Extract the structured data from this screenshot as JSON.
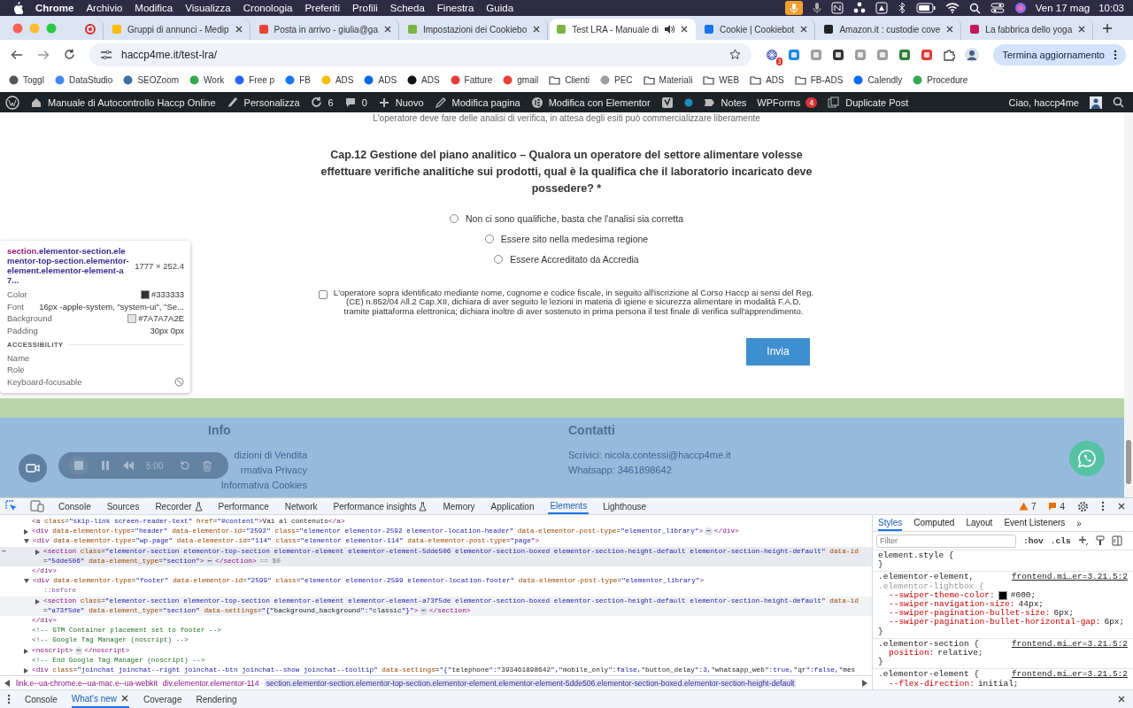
{
  "menu_bar": {
    "app": "Chrome",
    "menus": [
      "Archivio",
      "Modifica",
      "Visualizza",
      "Cronologia",
      "Preferiti",
      "Profili",
      "Scheda",
      "Finestra",
      "Guida"
    ],
    "date": "Ven 17 mag",
    "time": "10:03"
  },
  "tabs": [
    {
      "kind": "pinned",
      "selected": false,
      "audio": false,
      "color": "#d93025"
    },
    {
      "kind": "normal",
      "title": "Gruppi di annunci - Medip",
      "selected": false,
      "audio": false,
      "color": "#fbbc04"
    },
    {
      "kind": "normal",
      "title": "Posta in arrivo - giulia@ga",
      "selected": false,
      "audio": false,
      "color": "#ea4335"
    },
    {
      "kind": "normal",
      "title": "Impostazioni dei Cookiebo",
      "selected": false,
      "audio": false,
      "color": "#7cb342"
    },
    {
      "kind": "normal",
      "title": "Test LRA - Manuale di",
      "selected": true,
      "audio": true,
      "color": "#7cb342"
    },
    {
      "kind": "normal",
      "title": "Cookie | Cookiebot",
      "selected": false,
      "audio": false,
      "color": "#1a73e8"
    },
    {
      "kind": "normal",
      "title": "Amazon.it : custodie cove",
      "selected": false,
      "audio": false,
      "color": "#222222"
    },
    {
      "kind": "normal",
      "title": "La fabbrica dello yoga",
      "selected": false,
      "audio": false,
      "color": "#c2185b"
    }
  ],
  "address_bar": {
    "url": "haccp4me.it/test-lra/"
  },
  "extension_badge": "3",
  "update_button": "Termina aggiornamento",
  "bookmarks": [
    {
      "kind": "site",
      "label": "Toggl",
      "color": "#555555"
    },
    {
      "kind": "site",
      "label": "DataStudio",
      "color": "#4285f4"
    },
    {
      "kind": "site",
      "label": "SEOZoom",
      "color": "#3c6e9f"
    },
    {
      "kind": "site",
      "label": "Work",
      "color": "#34a853"
    },
    {
      "kind": "site",
      "label": "Free p",
      "color": "#2962ff"
    },
    {
      "kind": "site",
      "label": "FB",
      "color": "#1877f2"
    },
    {
      "kind": "site",
      "label": "ADS",
      "color": "#fbbc04"
    },
    {
      "kind": "site",
      "label": "ADS",
      "color": "#0668e1"
    },
    {
      "kind": "site",
      "label": "ADS",
      "color": "#111111"
    },
    {
      "kind": "site",
      "label": "Fatture",
      "color": "#e53935"
    },
    {
      "kind": "site",
      "label": "gmail",
      "color": "#ea4335"
    },
    {
      "kind": "folder",
      "label": "Clienti"
    },
    {
      "kind": "site",
      "label": "PEC",
      "color": "#9e9e9e"
    },
    {
      "kind": "folder",
      "label": "Materiali"
    },
    {
      "kind": "folder",
      "label": "WEB"
    },
    {
      "kind": "folder",
      "label": "ADS"
    },
    {
      "kind": "folder",
      "label": "FB-ADS"
    },
    {
      "kind": "site",
      "label": "Calendly",
      "color": "#006bff"
    },
    {
      "kind": "site",
      "label": "Procedure",
      "color": "#34a853"
    }
  ],
  "admin_bar": {
    "items": [
      {
        "label": "Manuale di Autocontrollo Haccp Online"
      },
      {
        "label": "Personalizza"
      },
      {
        "label": "6"
      },
      {
        "label": "0"
      },
      {
        "label": "Nuovo"
      },
      {
        "label": "Modifica pagina"
      },
      {
        "label": "Modifica con Elementor"
      },
      {
        "label": "Notes"
      },
      {
        "label": "WPForms",
        "badge": "4"
      },
      {
        "label": "Duplicate Post"
      }
    ],
    "greeting": "Ciao, haccp4me"
  },
  "page": {
    "previous_option": "L'operatore deve fare delle analisi di verifica, in attesa degli esiti può commercializzare liberamente",
    "question": "Cap.12 Gestione del piano analitico – Qualora un operatore del settore alimentare volesse effettuare verifiche analitiche sui prodotti, qual è la qualifica che il laboratorio incaricato deve possedere? *",
    "options": [
      {
        "label": "Non ci sono qualifiche, basta che l'analisi sia corretta",
        "selected": false
      },
      {
        "label": "Essere sito nella medesima regione",
        "selected": false
      },
      {
        "label": "Essere Accreditato da Accredia",
        "selected": false
      }
    ],
    "consent": {
      "text": "L'operatore sopra identificato mediante nome, cognome e codice fiscale, in seguito all'iscrizione al Corso Haccp ai sensi del Reg.(CE) n.852/04 All.2 Cap.XII, dichiara di aver seguito le lezioni in materia di igiene e sicurezza alimentare in modalità F.A.D. tramite piattaforma elettronica; dichiara inoltre di aver sostenuto in prima persona il test finale di verifica sull'apprendimento.",
      "checked": false
    },
    "submit": "Invia"
  },
  "footer": {
    "columns": [
      {
        "heading": "Info",
        "links": [
          "dizioni di Vendita",
          "rmativa Privacy",
          "Informativa Cookies"
        ]
      },
      {
        "heading": "Contatti",
        "links": [
          "Scrivici: nicola.contessi@haccp4me.it",
          "Whatsapp: 3461898642"
        ]
      }
    ]
  },
  "recorder": {
    "time": "5:00"
  },
  "inspector_tooltip": {
    "tag": "section",
    "classes": ".elementor-section.elementor-top-section.elementor-element.elementor-element-a7...",
    "size": "1777 × 252.4",
    "rows": [
      {
        "label": "Color",
        "value": "#333333",
        "color": "#333333"
      },
      {
        "label": "Font",
        "value": "16px -apple-system, \"system-ui\", \"Se..."
      },
      {
        "label": "Background",
        "value": "#7A7A7A2E",
        "color": "#e4e4e4"
      },
      {
        "label": "Padding",
        "value": "30px 0px"
      }
    ],
    "section": "ACCESSIBILITY",
    "a11y": [
      {
        "label": "Name"
      },
      {
        "label": "Role"
      },
      {
        "label": "Keyboard-focusable",
        "focusable": false
      }
    ]
  },
  "devtools": {
    "tabs": [
      {
        "label": "Console",
        "selected": false,
        "experimental": false
      },
      {
        "label": "Sources",
        "selected": false,
        "experimental": false
      },
      {
        "label": "Recorder",
        "selected": false,
        "experimental": true
      },
      {
        "label": "Performance",
        "selected": false,
        "experimental": false
      },
      {
        "label": "Network",
        "selected": false,
        "experimental": false
      },
      {
        "label": "Performance insights",
        "selected": false,
        "experimental": true
      },
      {
        "label": "Memory",
        "selected": false,
        "experimental": false
      },
      {
        "label": "Application",
        "selected": false,
        "experimental": false
      },
      {
        "label": "Elements",
        "selected": true,
        "experimental": false
      },
      {
        "label": "Lighthouse",
        "selected": false,
        "experimental": false
      }
    ],
    "warnings": "7",
    "issues": "4",
    "dom": [
      {
        "kind": "leaf",
        "open": "<a class=\"skip-link screen-reader-text\" href=\"#content\">Vai al contenuto</a>",
        "selected": false,
        "hovered": false
      },
      {
        "kind": "element",
        "open": "<div data-elementor-type=\"header\" data-elementor-id=\"2592\" class=\"elementor elementor-2592 elementor-location-header\" data-elementor-post-type=\"elementor_library\">",
        "badge": "⋯",
        "close": "</div>",
        "expanded": false,
        "selected": false,
        "hovered": false
      },
      {
        "kind": "element",
        "open": "<div data-elementor-type=\"wp-page\" data-elementor-id=\"114\" class=\"elementor elementor-114\" data-elementor-post-type=\"page\">",
        "close": "</div>",
        "expanded": true,
        "selected": false,
        "hovered": false,
        "children": [
          {
            "kind": "element",
            "open": "<section class=\"elementor-section elementor-top-section elementor-element elementor-element-5dde506 elementor-section-boxed elementor-section-height-default elementor-section-height-default\" data-id=\"5dde506\" data-element_type=\"section\">",
            "badge": "⋯",
            "close": "</section>",
            "gutter": "⋯",
            "marker": "== $0",
            "expanded": false,
            "selected": true,
            "hovered": false
          }
        ]
      },
      {
        "kind": "element",
        "open": "<div data-elementor-type=\"footer\" data-elementor-id=\"2599\" class=\"elementor elementor-2599 elementor-location-footer\" data-elementor-post-type=\"elementor_library\">",
        "close": "</div>",
        "expanded": true,
        "selected": false,
        "hovered": false,
        "children": [
          {
            "kind": "pseudo",
            "open": "::before",
            "selected": false,
            "hovered": false
          },
          {
            "kind": "element",
            "open": "<section class=\"elementor-section elementor-top-section elementor-element elementor-element-a73f5de elementor-section-boxed elementor-section-height-default elementor-section-height-default\" data-id=\"a73f5de\" data-element_type=\"section\" data-settings=\"{\"background_background\":\"classic\"}\">",
            "badge": "⋯",
            "close": "</section>",
            "expanded": false,
            "selected": false,
            "hovered": true
          }
        ]
      },
      {
        "kind": "comment",
        "open": "<!-- GTM Container placement set to footer -->",
        "selected": false,
        "hovered": false
      },
      {
        "kind": "comment",
        "open": "<!-- Google Tag Manager (noscript) -->",
        "selected": false,
        "hovered": false
      },
      {
        "kind": "element",
        "open": "<noscript>",
        "badge": "⋯",
        "close": "</noscript>",
        "expanded": false,
        "selected": false,
        "hovered": false
      },
      {
        "kind": "comment",
        "open": "<!-- End Google Tag Manager (noscript) -->",
        "selected": false,
        "hovered": false
      },
      {
        "kind": "element",
        "open": "<div class=\"joinchat joinchat--right joinchat--btn joinchat--show joinchat--tooltip\" data-settings=\"{\"telephone\":\"393461898642\",\"mobile_only\":false,\"button_delay\":3,\"whatsapp_web\":true,\"qr\":false,\"mes",
        "expanded": false,
        "selected": false,
        "hovered": false
      }
    ],
    "breadcrumbs": [
      {
        "text": "link.e--ua-chrome.e--ua-mac.e--ua-webkit",
        "selected": false
      },
      {
        "text": "div.elementor.elementor-114",
        "selected": false
      },
      {
        "text": "section.elementor-section.elementor-top-section.elementor-element.elementor-element-5dde506.elementor-section-boxed.elementor-section-height-default",
        "selected": true
      }
    ],
    "styles_tabs": [
      {
        "label": "Styles",
        "selected": true
      },
      {
        "label": "Computed",
        "selected": false
      },
      {
        "label": "Layout",
        "selected": false
      },
      {
        "label": "Event Listeners",
        "selected": false
      }
    ],
    "more_tabs": "»",
    "filter_placeholder": "Filter",
    "toggles": [
      ":hov",
      ".cls"
    ],
    "rules": [
      {
        "selector": [
          {
            "text": "element.style {",
            "matched": true
          }
        ],
        "close": "}"
      },
      {
        "selector": [
          {
            "text": ".elementor-element, ",
            "matched": true
          },
          {
            "text": ".elementor-lightbox {",
            "matched": false
          }
        ],
        "source": "frontend.mi…er=3.21.5:2",
        "close": "}",
        "props": [
          {
            "name": "--swiper-theme-color:",
            "value": "#000;",
            "color": "#000000"
          },
          {
            "name": "--swiper-navigation-size:",
            "value": "44px;"
          },
          {
            "name": "--swiper-pagination-bullet-size:",
            "value": "6px;"
          },
          {
            "name": "--swiper-pagination-bullet-horizontal-gap:",
            "value": "6px;"
          }
        ]
      },
      {
        "selector": [
          {
            "text": ".elementor-section {",
            "matched": true
          }
        ],
        "source": "frontend.mi…er=3.21.5:2",
        "close": "}",
        "props": [
          {
            "name": "position:",
            "value": "relative;"
          }
        ]
      },
      {
        "selector": [
          {
            "text": ".elementor-element {",
            "matched": true
          }
        ],
        "source": "frontend.mi…er=3.21.5:2",
        "props": [
          {
            "name": "--flex-direction:",
            "value": "initial;"
          }
        ]
      }
    ],
    "drawer_tabs": [
      {
        "label": "Console",
        "selected": false,
        "closable": false
      },
      {
        "label": "What's new",
        "selected": true,
        "closable": true
      },
      {
        "label": "Coverage",
        "selected": false,
        "closable": false
      },
      {
        "label": "Rendering",
        "selected": false,
        "closable": false
      }
    ]
  }
}
